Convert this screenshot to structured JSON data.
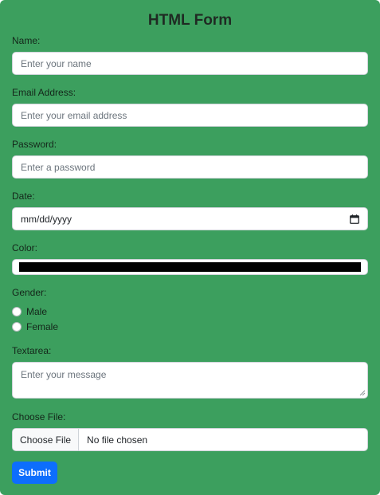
{
  "form": {
    "title": "HTML Form",
    "name": {
      "label": "Name:",
      "placeholder": "Enter your name"
    },
    "email": {
      "label": "Email Address:",
      "placeholder": "Enter your email address"
    },
    "password": {
      "label": "Password:",
      "placeholder": "Enter a password"
    },
    "date": {
      "label": "Date:",
      "value": "mm/dd/yyyy",
      "icon": "calendar-icon"
    },
    "color": {
      "label": "Color:",
      "value": "#000000"
    },
    "gender": {
      "label": "Gender:",
      "options": [
        {
          "label": "Male",
          "checked": false
        },
        {
          "label": "Female",
          "checked": false
        }
      ]
    },
    "textarea": {
      "label": "Textarea:",
      "placeholder": "Enter your message"
    },
    "file": {
      "label": "Choose File:",
      "button": "Choose File",
      "status": "No file chosen"
    },
    "submit": "Submit"
  },
  "colors": {
    "background": "#3c9f5e",
    "submit": "#0d6efd"
  }
}
